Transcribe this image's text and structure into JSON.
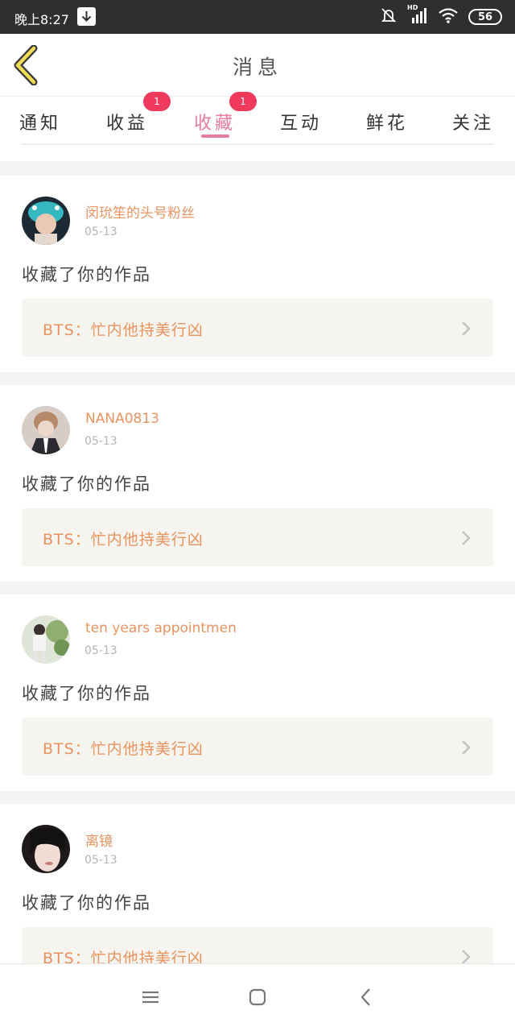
{
  "status_bar": {
    "time": "晚上8:27",
    "battery": "56",
    "network_label": "HD",
    "icons": [
      "download-icon",
      "silent-bell-icon",
      "signal-icon",
      "wifi-icon",
      "battery-icon"
    ]
  },
  "header": {
    "title": "消息",
    "back_icon": "back-chevron-icon"
  },
  "tabs": [
    {
      "label": "通知"
    },
    {
      "label": "收益",
      "badge": "1"
    },
    {
      "label": "收藏",
      "badge": "1",
      "active": true
    },
    {
      "label": "互动"
    },
    {
      "label": "鲜花"
    },
    {
      "label": "关注"
    }
  ],
  "notifications": [
    {
      "username": "闵玧笙的头号粉丝",
      "date": "05-13",
      "action": "收藏了你的作品",
      "work_title": "BTS：忙内他持美行凶"
    },
    {
      "username": "NANA0813",
      "date": "05-13",
      "action": "收藏了你的作品",
      "work_title": "BTS：忙内他持美行凶"
    },
    {
      "username": "ten years appointmen",
      "date": "05-13",
      "action": "收藏了你的作品",
      "work_title": "BTS：忙内他持美行凶"
    },
    {
      "username": "离镜",
      "date": "05-13",
      "action": "收藏了你的作品",
      "work_title": "BTS：忙内他持美行凶"
    }
  ],
  "colors": {
    "accent_pink": "#e67aa3",
    "badge_red": "#ef3a5d",
    "username_orange": "#e8935f",
    "link_bg": "#f5f4ee"
  },
  "nav_icons": [
    "menu-icon",
    "home-square-icon",
    "back-triangle-icon"
  ]
}
